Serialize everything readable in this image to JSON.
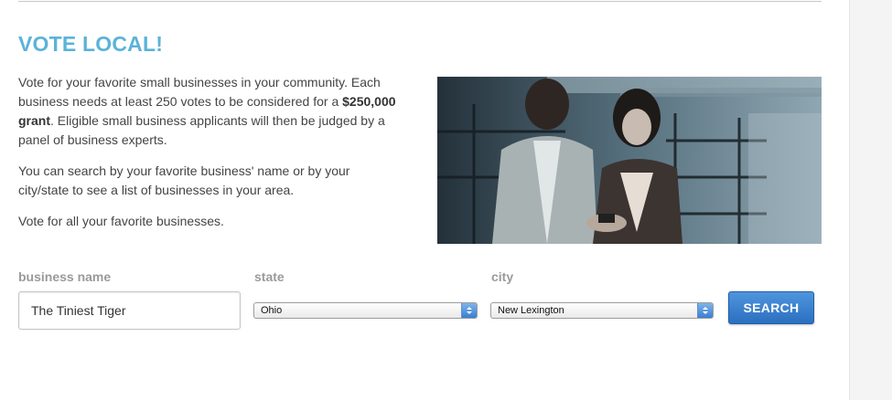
{
  "page": {
    "title": "VOTE LOCAL!",
    "intro": {
      "p1_before": "Vote for your favorite small businesses in your community. Each business needs at least 250 votes to be considered for a ",
      "p1_bold": "$250,000 grant",
      "p1_after": ". Eligible small business applicants will then be judged by a panel of business experts.",
      "p2": "You can search by your favorite business' name or by your city/state to see a list of businesses in your area.",
      "p3": "Vote for all your favorite businesses."
    }
  },
  "search_form": {
    "business_label": "business name",
    "business_value": "The Tiniest Tiger",
    "state_label": "state",
    "state_value": "Ohio",
    "city_label": "city",
    "city_value": "New Lexington",
    "search_label": "SEARCH"
  },
  "colors": {
    "title": "#5bb3d8",
    "button": "#2b6fc0",
    "label": "#9a9a9a"
  }
}
